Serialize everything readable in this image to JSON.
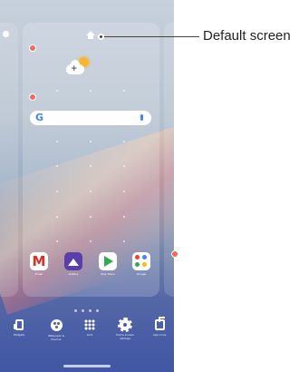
{
  "callout": {
    "label": "Default screen"
  },
  "home_screen": {
    "search_bar": {
      "logo": "G",
      "mic_icon": "mic-icon"
    },
    "weather_widget": {
      "icon": "partly-cloudy-icon",
      "add_symbol": "+"
    },
    "apps": [
      {
        "name": "Email",
        "icon": "email-icon"
      },
      {
        "name": "Gallery",
        "icon": "gallery-icon"
      },
      {
        "name": "Play Store",
        "icon": "play-store-icon"
      },
      {
        "name": "Google",
        "icon": "google-folder-icon"
      }
    ]
  },
  "edit_bar": [
    {
      "label": "Widgets",
      "icon": "widgets-icon"
    },
    {
      "label": "Wallpaper &\nthemes",
      "icon": "palette-icon"
    },
    {
      "label": "Grid",
      "icon": "grid-icon"
    },
    {
      "label": "Home screen\nsettings",
      "icon": "gear-icon"
    },
    {
      "label": "App icons",
      "icon": "transparent-icon"
    }
  ],
  "colors": {
    "remove_badge": "#f06a5d",
    "play_green": "#34a853",
    "gallery_purple": "#5b3fa8",
    "mail_red": "#d93025"
  }
}
